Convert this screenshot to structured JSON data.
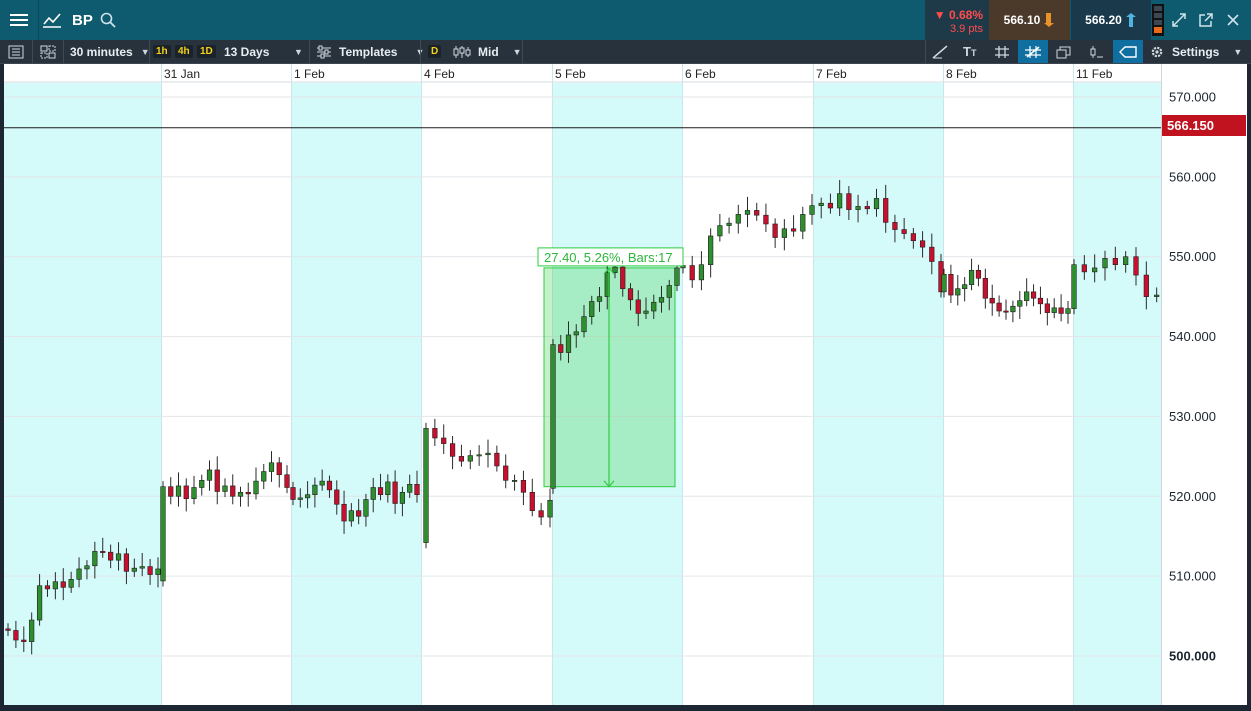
{
  "header": {
    "symbol": "BP",
    "change_percent": "0.68%",
    "change_points": "3.9 pts",
    "sell_price": "566.10",
    "buy_price": "566.20"
  },
  "toolbar": {
    "interval": "30 minutes",
    "quick_intervals": [
      "1h",
      "4h",
      "1D"
    ],
    "range": "13 Days",
    "templates_label": "Templates",
    "d_badge": "D",
    "price_type": "Mid",
    "settings_label": "Settings"
  },
  "chart_data": {
    "type": "candlestick",
    "instrument": "BP",
    "interval": "30 minutes",
    "x_labels": [
      "31 Jan",
      "1 Feb",
      "4 Feb",
      "5 Feb",
      "6 Feb",
      "7 Feb",
      "8 Feb",
      "11 Feb"
    ],
    "y_ticks": [
      "570.000",
      "560.000",
      "550.000",
      "540.000",
      "530.000",
      "520.000",
      "510.000",
      "500.000"
    ],
    "ylim": [
      496,
      572
    ],
    "current_price_label": "566.150",
    "current_price": 566.15,
    "measure_label": "27.40, 5.26%, Bars:17",
    "measure_from": 521.2,
    "measure_to": 548.6,
    "grid": true,
    "colors": {
      "up": "#2f8f2f",
      "down": "#c8102e",
      "session_shade": "#d5fafa",
      "measure": "#2ecc40"
    },
    "closes": [
      [
        503.2,
        502.0,
        501.8,
        504.5,
        508.8,
        508.4,
        509.3,
        508.6,
        509.6,
        510.9,
        511.3,
        513.1,
        513.0,
        512.0,
        512.8,
        510.6,
        511.0,
        511.2,
        510.2,
        510.9
      ],
      [
        521.2,
        520.0,
        521.3,
        519.7,
        521.1,
        522.0,
        523.3,
        520.6,
        521.3,
        520.0,
        520.5,
        520.3,
        521.9,
        523.1,
        524.2,
        522.7,
        521.1
      ],
      [
        519.6,
        519.8,
        520.2,
        521.4,
        521.9,
        520.8,
        519.0,
        516.9,
        518.2,
        517.5,
        519.6,
        521.1,
        520.2,
        521.8,
        519.1,
        520.5,
        521.5,
        520.2
      ],
      [
        528.5,
        527.3,
        526.6,
        525.0,
        524.4,
        525.1,
        525.2,
        525.4,
        523.8,
        522.0,
        522.0,
        520.5,
        518.2,
        517.4,
        519.5
      ],
      [
        539.0,
        538.0,
        540.2,
        540.6,
        542.5,
        544.4,
        545.0,
        548.0,
        548.7,
        546.0,
        544.6,
        542.9,
        543.2,
        544.3,
        544.9,
        546.4,
        548.6
      ],
      [
        548.9,
        547.1,
        549.0,
        552.6,
        553.9,
        554.2,
        555.3,
        555.8,
        555.2,
        554.1,
        552.4,
        553.5,
        553.2,
        555.3,
        556.4,
        556.7,
        556.1,
        557.9,
        555.9,
        556.3,
        556.0,
        557.3,
        554.3,
        553.4,
        552.9,
        552.0,
        551.2,
        549.4,
        545.6
      ],
      [
        547.8,
        545.2,
        546.0,
        546.5,
        548.3,
        547.3,
        544.8,
        544.2,
        543.2,
        543.1,
        543.8,
        544.5,
        545.6,
        544.8,
        544.1,
        543.0,
        543.6,
        542.9,
        543.5
      ],
      [
        549.0,
        548.1,
        548.6,
        549.8,
        549.0,
        550.0,
        547.7,
        545.0,
        545.2,
        545.4,
        546.2,
        547.6,
        546.0
      ]
    ]
  }
}
